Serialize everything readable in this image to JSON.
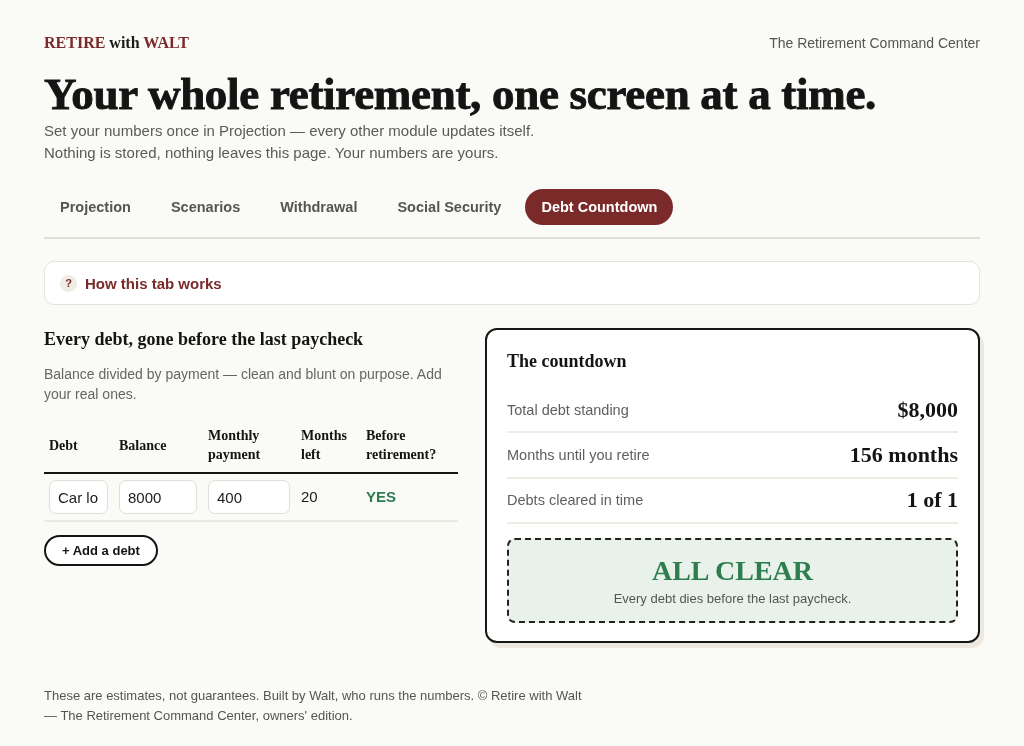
{
  "brand": {
    "parts": [
      {
        "text": "RETIRE",
        "accent": true
      },
      {
        "text": "with",
        "accent": false
      },
      {
        "text": "WALT",
        "accent": true
      }
    ]
  },
  "tagline": "The Retirement Command Center",
  "headline": "Your whole retirement, one screen at a time.",
  "subtitle_lines": [
    "Set your numbers once in Projection — every other module updates itself.",
    "Nothing is stored, nothing leaves this page. Your numbers are yours."
  ],
  "tabs": [
    {
      "label": "Projection",
      "selected": false
    },
    {
      "label": "Scenarios",
      "selected": false
    },
    {
      "label": "Withdrawal",
      "selected": false
    },
    {
      "label": "Social Security",
      "selected": false
    },
    {
      "label": "Debt Countdown",
      "selected": true
    }
  ],
  "help": {
    "icon": "?",
    "label": "How this tab works"
  },
  "debts": {
    "title": "Every debt, gone before the last paycheck",
    "description": "Balance divided by payment — clean and blunt on purpose. Add your real ones.",
    "table": {
      "columns": [
        "Debt",
        "Balance",
        "Monthly payment",
        "Months left",
        "Before retirement?"
      ],
      "rows": [
        {
          "cells": [
            {
              "kind": "input",
              "value": "Car lo"
            },
            {
              "kind": "input",
              "value": "8000"
            },
            {
              "kind": "input",
              "value": "400"
            },
            {
              "kind": "text",
              "value": "20"
            },
            {
              "kind": "status",
              "value": "YES",
              "on_time": true
            }
          ]
        }
      ]
    },
    "add_button": "+ Add a debt"
  },
  "countdown": {
    "title": "The countdown",
    "rows": [
      {
        "label": "Total debt standing",
        "value": "$8,000"
      },
      {
        "label": "Months until you retire",
        "value": "156 months"
      },
      {
        "label": "Debts cleared in time",
        "value": "1 of 1"
      }
    ],
    "verdict": {
      "title": "ALL CLEAR",
      "note": "Every debt dies before the last paycheck.",
      "clear": true
    }
  },
  "footer": "These are estimates, not guarantees. Built by Walt, who runs the numbers. © Retire with Walt — The Retirement Command Center, owners' edition."
}
